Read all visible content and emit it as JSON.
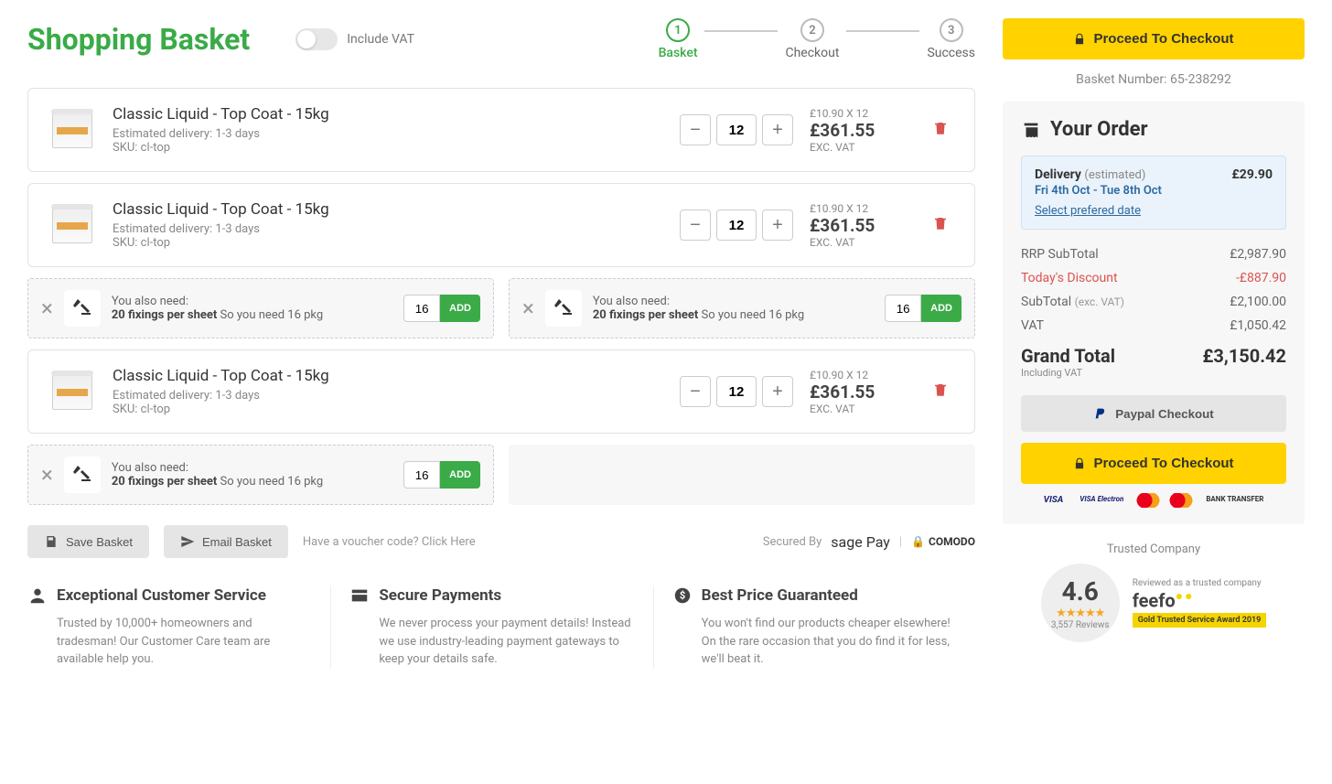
{
  "header": {
    "title": "Shopping Basket",
    "vat_toggle_label": "Include VAT",
    "steps": [
      {
        "num": "1",
        "label": "Basket"
      },
      {
        "num": "2",
        "label": "Checkout"
      },
      {
        "num": "3",
        "label": "Success"
      }
    ]
  },
  "items": [
    {
      "name": "Classic Liquid - Top Coat - 15kg",
      "delivery": "Estimated delivery: 1-3 days",
      "sku": "SKU: cl-top",
      "qty": "12",
      "unit": "£10.90 X 12",
      "total": "£361.55",
      "exvat": "EXC. VAT"
    },
    {
      "name": "Classic Liquid - Top Coat - 15kg",
      "delivery": "Estimated delivery: 1-3 days",
      "sku": "SKU: cl-top",
      "qty": "12",
      "unit": "£10.90 X 12",
      "total": "£361.55",
      "exvat": "EXC. VAT"
    },
    {
      "name": "Classic Liquid - Top Coat - 15kg",
      "delivery": "Estimated delivery: 1-3 days",
      "sku": "SKU: cl-top",
      "qty": "12",
      "unit": "£10.90 X 12",
      "total": "£361.55",
      "exvat": "EXC. VAT"
    }
  ],
  "addon": {
    "intro": "You also need:",
    "bold": "20 fixings per sheet",
    "rest": " So you need 16 pkg",
    "qty": "16",
    "add": "ADD"
  },
  "actions": {
    "save": "Save  Basket",
    "email": "Email  Basket",
    "voucher": "Have a voucher code? Click Here",
    "secured_by": "Secured By",
    "sage": "sage",
    "sage2": " Pay",
    "comodo": "COMODO"
  },
  "features": [
    {
      "title": "Exceptional Customer Service",
      "body": "Trusted by 10,000+ homeowners and tradesman! Our Customer Care team are available help you."
    },
    {
      "title": "Secure Payments",
      "body": "We never process your payment details! Instead we use industry-leading payment gateways to keep your details safe."
    },
    {
      "title": "Best Price Guaranteed",
      "body": "You won't find our products cheaper elsewhere! On the rare occasion that you do find it for less, we'll beat it."
    }
  ],
  "side": {
    "checkout": "Proceed To Checkout",
    "basket_number": "Basket Number: 65-238292",
    "order_title": "Your Order",
    "delivery": {
      "label": "Delivery",
      "est": "(estimated)",
      "price": "£29.90",
      "date": "Fri 4th Oct - Tue 8th Oct",
      "link": "Select prefered date"
    },
    "rows": {
      "rrp_label": "RRP SubTotal",
      "rrp_val": "£2,987.90",
      "disc_label": "Today's Discount",
      "disc_val": "-£887.90",
      "sub_label": "SubTotal ",
      "sub_muted": "(exc. VAT)",
      "sub_val": "£2,100.00",
      "vat_label": "VAT",
      "vat_val": "£1,050.42",
      "grand_label": "Grand Total",
      "grand_val": "£3,150.42",
      "grand_sub": "Including VAT"
    },
    "paypal": "Paypal Checkout",
    "pay_cards": {
      "visa": "VISA",
      "visae": "VISA Electron",
      "bank": "BANK TRANSFER"
    },
    "trusted": "Trusted Company",
    "rating": "4.6",
    "reviews": "3,557 Reviews",
    "feefo_sub": "Reviewed as a trusted company",
    "feefo": "feefo",
    "feefo_badge": "Gold Trusted Service Award 2019"
  }
}
